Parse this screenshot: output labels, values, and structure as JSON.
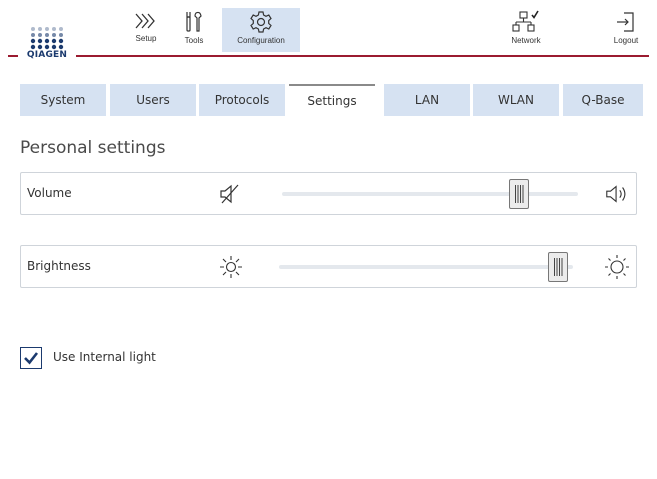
{
  "brand": {
    "logo_text": "QIAGEN",
    "accent_color": "#9b1b30",
    "logo_color": "#1b3a6e"
  },
  "header": {
    "nav": [
      {
        "label": "Setup",
        "icon": "chevrons-right-icon"
      },
      {
        "label": "Tools",
        "icon": "tools-icon"
      },
      {
        "label": "Configuration",
        "icon": "gear-icon",
        "active": true
      },
      {
        "label": "Network",
        "icon": "network-icon"
      },
      {
        "label": "Logout",
        "icon": "logout-icon"
      }
    ]
  },
  "tabs": [
    {
      "label": "System"
    },
    {
      "label": "Users"
    },
    {
      "label": "Protocols"
    },
    {
      "label": "Settings",
      "active": true
    },
    {
      "label": "LAN"
    },
    {
      "label": "WLAN"
    },
    {
      "label": "Q-Base"
    }
  ],
  "section": {
    "title": "Personal settings",
    "volume": {
      "label": "Volume",
      "level": 0.8,
      "min_icon": "speaker-muted-icon",
      "max_icon": "speaker-loud-icon"
    },
    "brightness": {
      "label": "Brightness",
      "level": 0.95,
      "min_icon": "sun-dim-icon",
      "max_icon": "sun-bright-icon"
    },
    "internal_light": {
      "label": "Use Internal light",
      "checked": true
    }
  },
  "colors": {
    "tab_bg": "#d6e2f2",
    "nav_active_bg": "#d6e2f2",
    "border": "#cfd4da"
  }
}
